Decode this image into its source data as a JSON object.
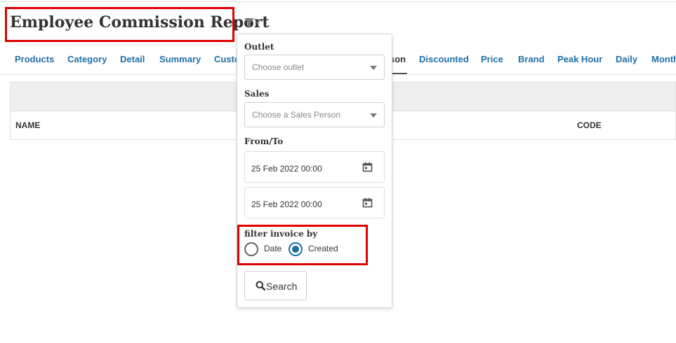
{
  "page": {
    "title": "Employee Commission Report"
  },
  "tabs": [
    {
      "label": "Products"
    },
    {
      "label": "Category"
    },
    {
      "label": "Detail"
    },
    {
      "label": "Summary"
    },
    {
      "label": "Custo"
    },
    {
      "label": "son"
    },
    {
      "label": "Discounted"
    },
    {
      "label": "Price"
    },
    {
      "label": "Brand"
    },
    {
      "label": "Peak Hour"
    },
    {
      "label": "Daily"
    },
    {
      "label": "Month"
    }
  ],
  "table": {
    "columns": [
      "NAME",
      "CODE"
    ]
  },
  "filter": {
    "outlet_label": "Outlet",
    "outlet_placeholder": "Choose outlet",
    "sales_label": "Sales",
    "sales_placeholder": "Choose a Sales Person",
    "fromto_label": "From/To",
    "from_value": "25 Feb 2022 00:00",
    "to_value": "25 Feb 2022 00:00",
    "invoice_label": "filter invoice by",
    "option_date": "Date",
    "option_created": "Created",
    "selected_option": "Created",
    "search_label": "Search"
  },
  "colors": {
    "link": "#1d6fa5",
    "highlight": "#e00000"
  }
}
